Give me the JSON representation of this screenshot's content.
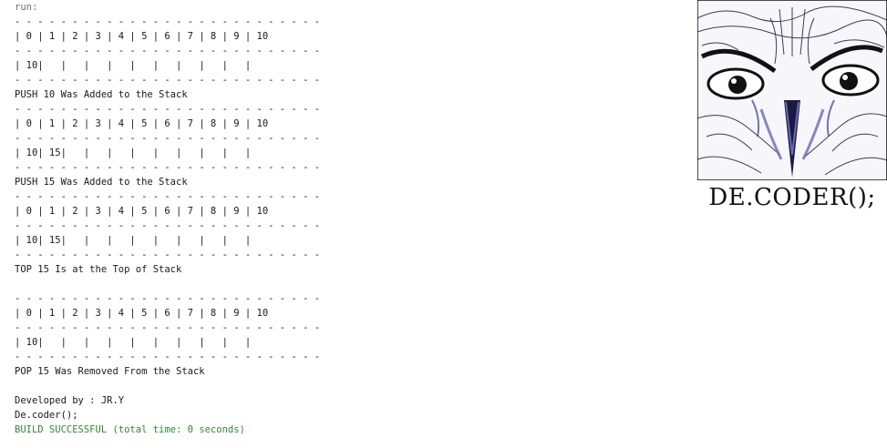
{
  "console": {
    "lines": [
      {
        "text": "run:",
        "style": "gray"
      },
      {
        "text": "- - - - - - - - - - - - - - - - - - - - - - - - - - -",
        "style": ""
      },
      {
        "text": "| 0 | 1 | 2 | 3 | 4 | 5 | 6 | 7 | 8 | 9 | 10",
        "style": ""
      },
      {
        "text": "- - - - - - - - - - - - - - - - - - - - - - - - - - -",
        "style": ""
      },
      {
        "text": "| 10|   |   |   |   |   |   |   |   |   |",
        "style": ""
      },
      {
        "text": "- - - - - - - - - - - - - - - - - - - - - - - - - - -",
        "style": ""
      },
      {
        "text": "PUSH 10 Was Added to the Stack",
        "style": ""
      },
      {
        "text": "- - - - - - - - - - - - - - - - - - - - - - - - - - -",
        "style": ""
      },
      {
        "text": "| 0 | 1 | 2 | 3 | 4 | 5 | 6 | 7 | 8 | 9 | 10",
        "style": ""
      },
      {
        "text": "- - - - - - - - - - - - - - - - - - - - - - - - - - -",
        "style": ""
      },
      {
        "text": "| 10| 15|   |   |   |   |   |   |   |   |",
        "style": ""
      },
      {
        "text": "- - - - - - - - - - - - - - - - - - - - - - - - - - -",
        "style": ""
      },
      {
        "text": "PUSH 15 Was Added to the Stack",
        "style": ""
      },
      {
        "text": "- - - - - - - - - - - - - - - - - - - - - - - - - - -",
        "style": ""
      },
      {
        "text": "| 0 | 1 | 2 | 3 | 4 | 5 | 6 | 7 | 8 | 9 | 10",
        "style": ""
      },
      {
        "text": "- - - - - - - - - - - - - - - - - - - - - - - - - - -",
        "style": ""
      },
      {
        "text": "| 10| 15|   |   |   |   |   |   |   |   |",
        "style": ""
      },
      {
        "text": "- - - - - - - - - - - - - - - - - - - - - - - - - - -",
        "style": ""
      },
      {
        "text": "TOP 15 Is at the Top of Stack",
        "style": ""
      },
      {
        "text": "",
        "style": ""
      },
      {
        "text": "- - - - - - - - - - - - - - - - - - - - - - - - - - -",
        "style": ""
      },
      {
        "text": "| 0 | 1 | 2 | 3 | 4 | 5 | 6 | 7 | 8 | 9 | 10",
        "style": ""
      },
      {
        "text": "- - - - - - - - - - - - - - - - - - - - - - - - - - -",
        "style": ""
      },
      {
        "text": "| 10|   |   |   |   |   |   |   |   |   |",
        "style": ""
      },
      {
        "text": "- - - - - - - - - - - - - - - - - - - - - - - - - - -",
        "style": ""
      },
      {
        "text": "POP 15 Was Removed From the Stack",
        "style": ""
      },
      {
        "text": "",
        "style": ""
      },
      {
        "text": "Developed by : JR.Y",
        "style": ""
      },
      {
        "text": "De.coder();",
        "style": ""
      },
      {
        "text": "BUILD SUCCESSFUL (total time: 0 seconds)",
        "style": "green"
      }
    ]
  },
  "logo": {
    "image_icon": "owl-sketch-icon",
    "text": "DE.CODER();"
  },
  "colors": {
    "run_text": "#707070",
    "success_text": "#2e8b2e",
    "owl_ink": "#1a1a40",
    "owl_accent": "#6a6ab8"
  }
}
